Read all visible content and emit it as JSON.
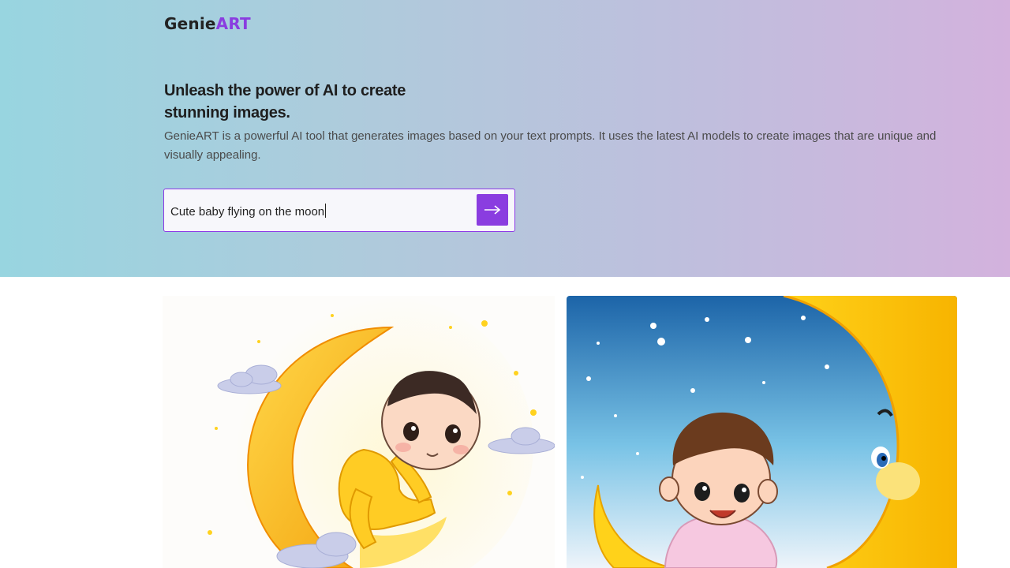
{
  "header": {
    "logo_part1": "Genie",
    "logo_part2": "ART"
  },
  "hero": {
    "headline_line1": "Unleash the power of AI to create",
    "headline_line2": "stunning images.",
    "description": "GenieART is a powerful AI tool that generates images based on your text prompts. It uses the latest AI models to create images that are unique and visually appealing."
  },
  "search": {
    "value": "Cute baby flying on the moon",
    "submit_icon": "arrow-right-icon"
  },
  "gallery": {
    "images": [
      {
        "name": "cartoon baby in yellow onesie on crescent moon"
      },
      {
        "name": "cartoon baby on smiling crescent moon in starry sky"
      }
    ]
  },
  "colors": {
    "accent": "#8a3de0",
    "hero_gradient_start": "#98d5e0",
    "hero_gradient_end": "#d3b2dd"
  }
}
